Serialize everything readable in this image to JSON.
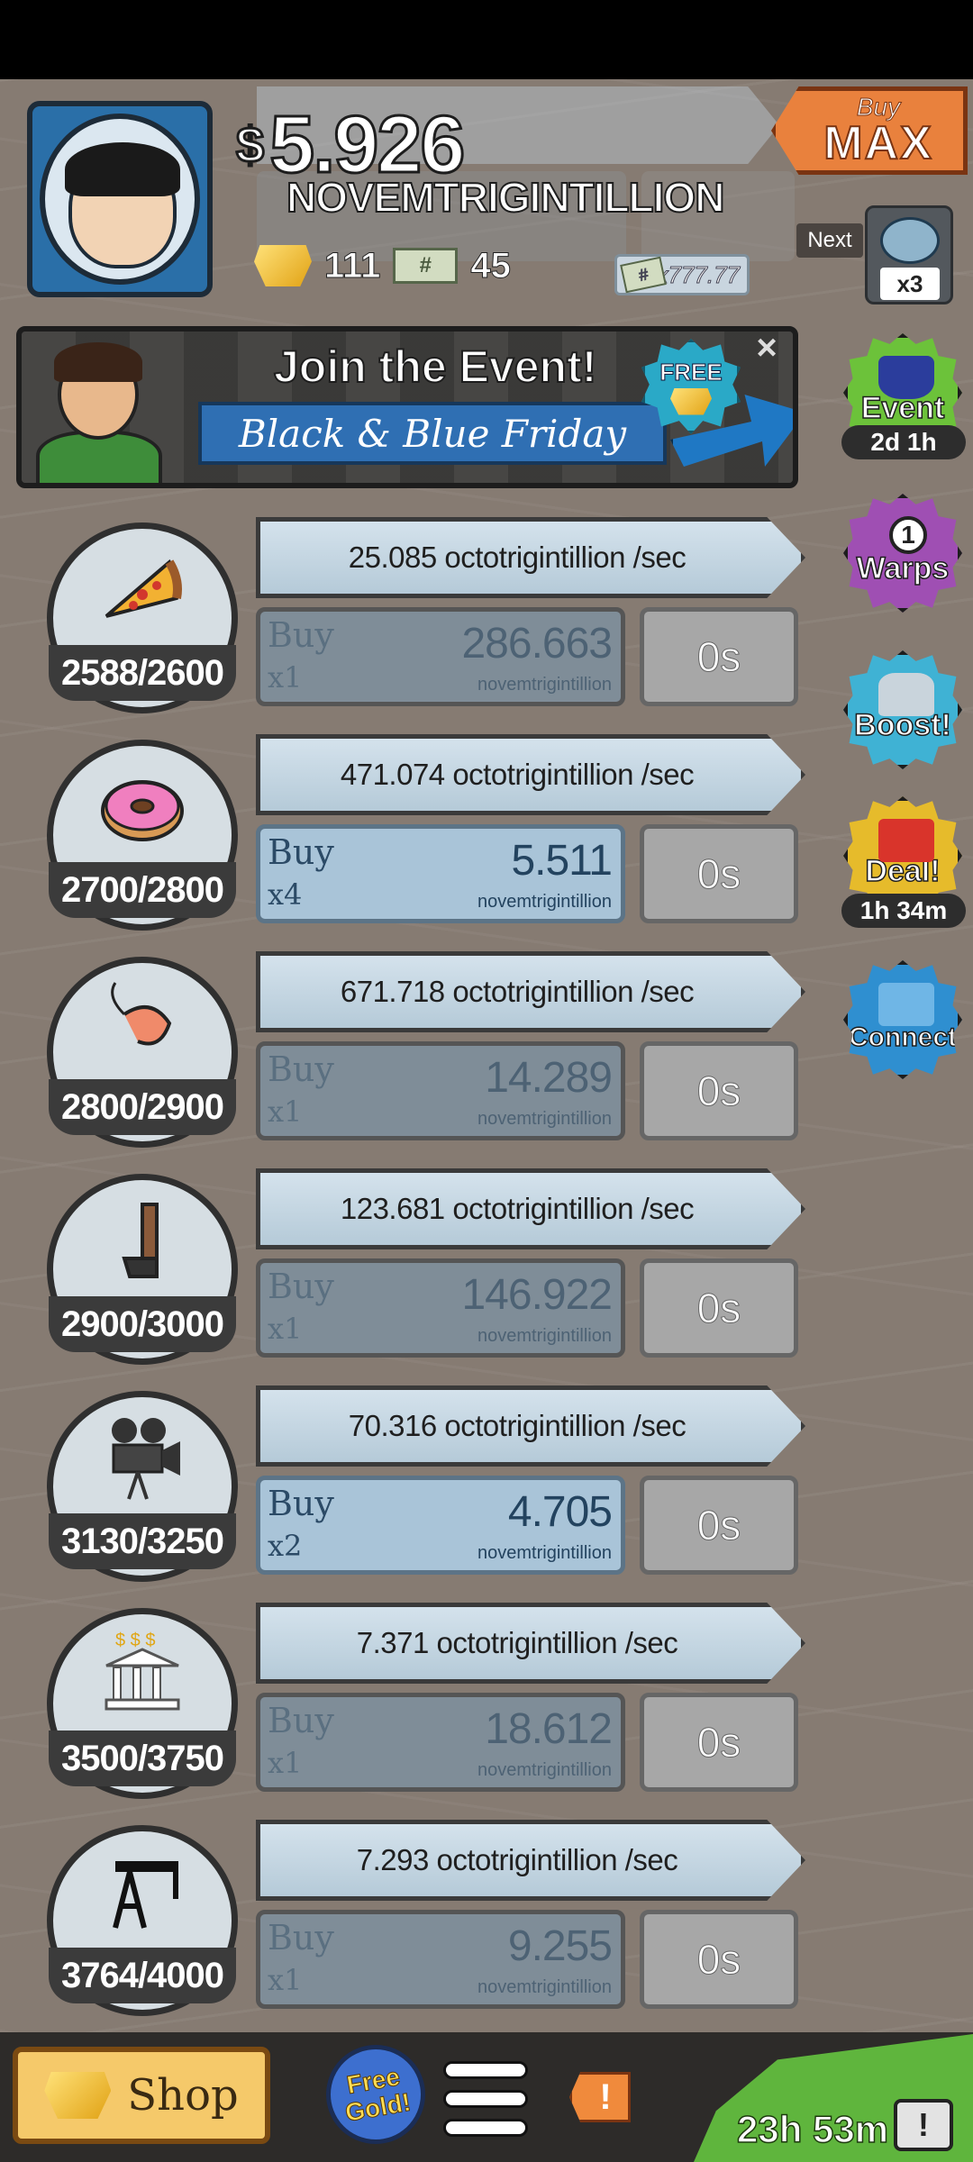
{
  "header": {
    "money_sign": "$",
    "money_value": "5.926",
    "money_unit": "NOVEMTRIGINTILLION",
    "gold_count": "111",
    "megabucks_count": "45",
    "multiplier_bill": "x777.77",
    "buy_max": {
      "buy": "Buy",
      "max": "MAX"
    },
    "next_label": "Next",
    "next_multiplier": "x3"
  },
  "event_banner": {
    "title": "Join the Event!",
    "subtitle": "Black & Blue Friday",
    "free_label": "FREE",
    "close": "×"
  },
  "side_badges": [
    {
      "label": "Event",
      "timer": "2d 1h",
      "color": "#6cc23a",
      "icon": "top-hat-icon"
    },
    {
      "label": "Warps",
      "number": "1",
      "color": "#9f4fb3",
      "icon": "timewarp-icon"
    },
    {
      "label": "Boost!",
      "color": "#3fb2d4",
      "icon": "car-icon"
    },
    {
      "label": "Deal!",
      "timer": "1h 34m",
      "color": "#e6bb2b",
      "icon": "gift-icon"
    },
    {
      "label": "Connect",
      "color": "#2f8fd0",
      "icon": "cards-icon"
    }
  ],
  "businesses": [
    {
      "icon": "pizza-icon",
      "count": "2588/2600",
      "rate": "25.085 octotrigintillion /sec",
      "buy": "Buy",
      "qty": "x1",
      "cost": "286.663",
      "cost_unit": "novemtrigintillion",
      "timer": "0s",
      "affordable": false
    },
    {
      "icon": "donut-icon",
      "count": "2700/2800",
      "rate": "471.074 octotrigintillion /sec",
      "buy": "Buy",
      "qty": "x4",
      "cost": "5.511",
      "cost_unit": "novemtrigintillion",
      "timer": "0s",
      "affordable": true
    },
    {
      "icon": "shrimp-icon",
      "count": "2800/2900",
      "rate": "671.718 octotrigintillion /sec",
      "buy": "Buy",
      "qty": "x1",
      "cost": "14.289",
      "cost_unit": "novemtrigintillion",
      "timer": "0s",
      "affordable": false
    },
    {
      "icon": "hockey-stick-icon",
      "count": "2900/3000",
      "rate": "123.681 octotrigintillion /sec",
      "buy": "Buy",
      "qty": "x1",
      "cost": "146.922",
      "cost_unit": "novemtrigintillion",
      "timer": "0s",
      "affordable": false
    },
    {
      "icon": "movie-camera-icon",
      "count": "3130/3250",
      "rate": "70.316 octotrigintillion /sec",
      "buy": "Buy",
      "qty": "x2",
      "cost": "4.705",
      "cost_unit": "novemtrigintillion",
      "timer": "0s",
      "affordable": true
    },
    {
      "icon": "bank-icon",
      "count": "3500/3750",
      "rate": "7.371 octotrigintillion /sec",
      "buy": "Buy",
      "qty": "x1",
      "cost": "18.612",
      "cost_unit": "novemtrigintillion",
      "timer": "0s",
      "affordable": false
    },
    {
      "icon": "oil-rig-icon",
      "count": "3764/4000",
      "rate": "7.293 octotrigintillion /sec",
      "buy": "Buy",
      "qty": "x1",
      "cost": "9.255",
      "cost_unit": "novemtrigintillion",
      "timer": "0s",
      "affordable": false
    }
  ],
  "bottom_bar": {
    "shop": "Shop",
    "free_gold": "Free Gold!",
    "alert": "!",
    "timer": "23h 53m",
    "tv_icon": "!"
  }
}
